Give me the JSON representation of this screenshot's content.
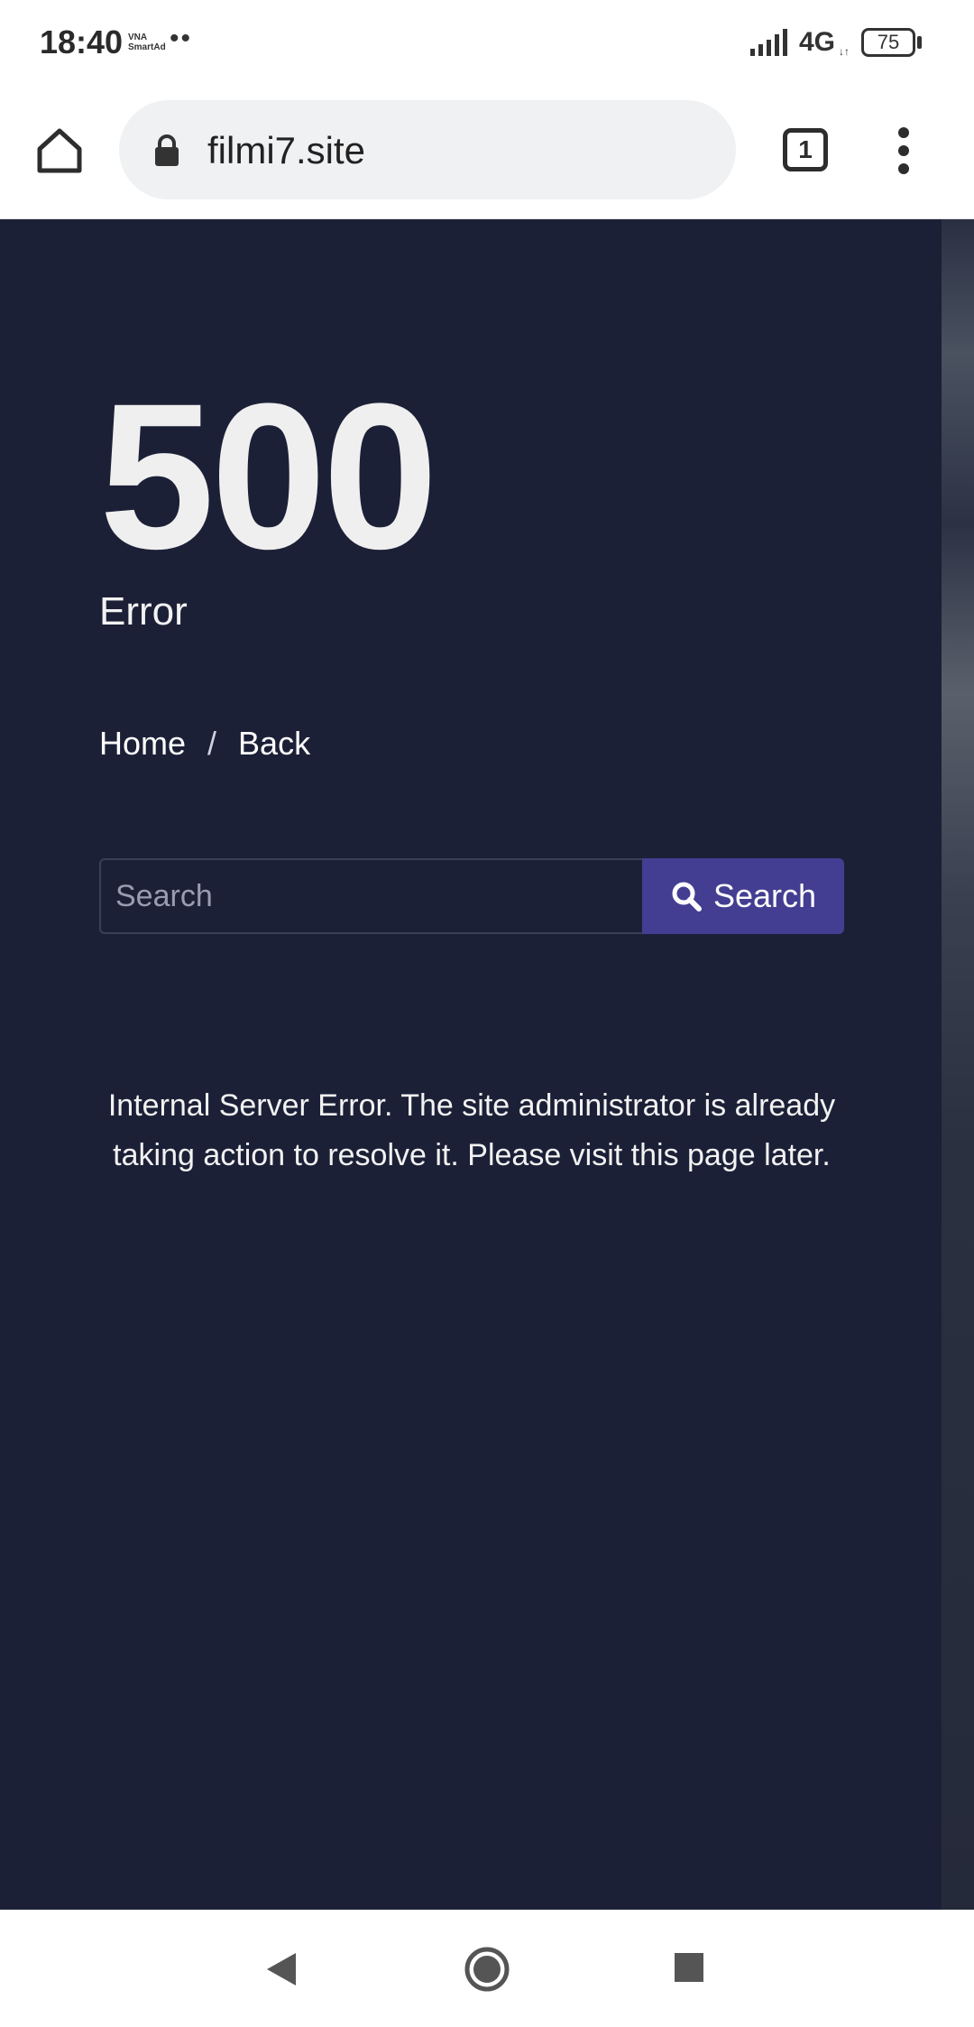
{
  "status_bar": {
    "time": "18:40",
    "carrier_badge": "VNA SmartAd",
    "dots": "••",
    "network": "4G",
    "network_arrows": "↓↑",
    "battery": "75"
  },
  "browser": {
    "url": "filmi7.site",
    "tab_count": "1",
    "icons": [
      "home-icon",
      "lock-icon",
      "tabs-icon",
      "menu-icon"
    ]
  },
  "page": {
    "error_code": "500",
    "error_label": "Error",
    "breadcrumb": {
      "home": "Home",
      "separator": "/",
      "back": "Back"
    },
    "search": {
      "placeholder": "Search",
      "button_label": "Search"
    },
    "message": "Internal Server Error. The site administrator is already taking action to resolve it. Please visit this page later."
  },
  "colors": {
    "page_bg": "#1c2037",
    "button_bg": "#433e91",
    "text": "#f2f2f2"
  }
}
